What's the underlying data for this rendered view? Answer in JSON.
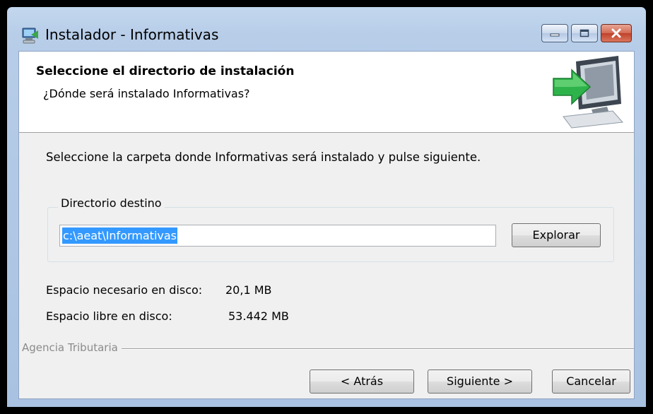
{
  "window": {
    "title": "Instalador - Informativas",
    "app_icon": "installer-computer-icon",
    "controls": [
      "minimize-icon",
      "maximize-icon",
      "close-icon"
    ]
  },
  "header": {
    "title": "Seleccione el directorio de instalación",
    "subtitle": "¿Dónde será instalado Informativas?",
    "icon": "install-arrow-computer-icon"
  },
  "body": {
    "instruction": "Seleccione la carpeta donde Informativas será instalado y pulse siguiente.",
    "destination": {
      "group_label": "Directorio destino",
      "path_value": "c:\\aeat\\Informativas",
      "browse_label": "Explorar"
    },
    "space": {
      "required_label": "Espacio necesario en disco:",
      "required_value": "20,1 MB",
      "free_label": "Espacio libre en disco:",
      "free_value": "53.442 MB"
    }
  },
  "footer": {
    "brand": "Agencia Tributaria",
    "back_label": "< Atrás",
    "next_label": "Siguiente >",
    "cancel_label": "Cancelar"
  },
  "colors": {
    "selection": "#3399ff",
    "arrow_green": "#2db34a",
    "close_red": "#c0412a"
  }
}
